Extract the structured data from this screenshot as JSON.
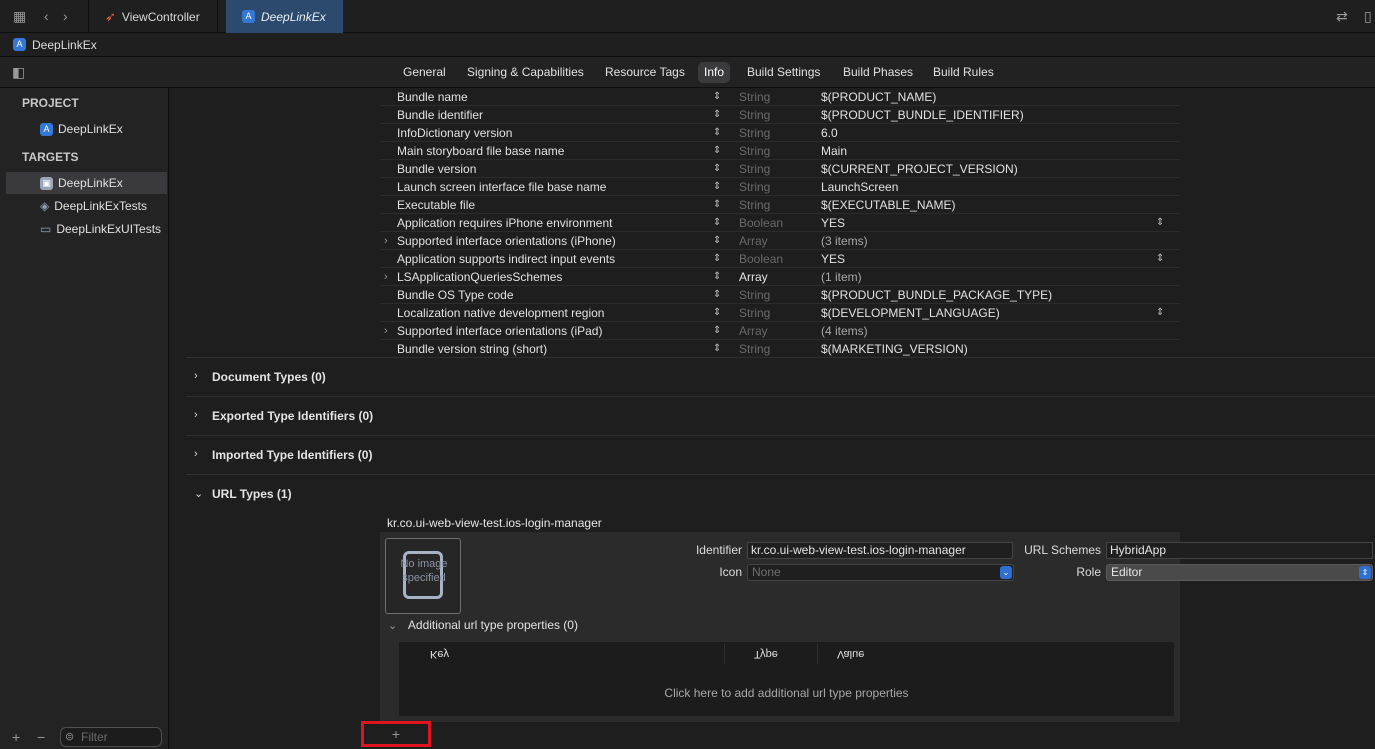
{
  "tabs": {
    "first": "ViewController",
    "second": "DeepLinkEx"
  },
  "jumpbar": {
    "project": "DeepLinkEx"
  },
  "segments": [
    "General",
    "Signing & Capabilities",
    "Resource Tags",
    "Info",
    "Build Settings",
    "Build Phases",
    "Build Rules"
  ],
  "active_segment": "Info",
  "sidebar": {
    "project_header": "PROJECT",
    "project_item": "DeepLinkEx",
    "targets_header": "TARGETS",
    "targets": [
      "DeepLinkEx",
      "DeepLinkExTests",
      "DeepLinkExUITests"
    ],
    "filter_placeholder": "Filter",
    "add_symbol": "+",
    "remove_symbol": "−"
  },
  "info_rows": [
    {
      "key": "Bundle name",
      "type": "String",
      "value": "$(PRODUCT_NAME)",
      "expandable": false,
      "value_popup": false,
      "type_strong": false,
      "value_dim": false
    },
    {
      "key": "Bundle identifier",
      "type": "String",
      "value": "$(PRODUCT_BUNDLE_IDENTIFIER)",
      "expandable": false,
      "value_popup": false,
      "type_strong": false,
      "value_dim": false
    },
    {
      "key": "InfoDictionary version",
      "type": "String",
      "value": "6.0",
      "expandable": false,
      "value_popup": false,
      "type_strong": false,
      "value_dim": false
    },
    {
      "key": "Main storyboard file base name",
      "type": "String",
      "value": "Main",
      "expandable": false,
      "value_popup": false,
      "type_strong": false,
      "value_dim": false
    },
    {
      "key": "Bundle version",
      "type": "String",
      "value": "$(CURRENT_PROJECT_VERSION)",
      "expandable": false,
      "value_popup": false,
      "type_strong": false,
      "value_dim": false
    },
    {
      "key": "Launch screen interface file base name",
      "type": "String",
      "value": "LaunchScreen",
      "expandable": false,
      "value_popup": false,
      "type_strong": false,
      "value_dim": false
    },
    {
      "key": "Executable file",
      "type": "String",
      "value": "$(EXECUTABLE_NAME)",
      "expandable": false,
      "value_popup": false,
      "type_strong": false,
      "value_dim": false
    },
    {
      "key": "Application requires iPhone environment",
      "type": "Boolean",
      "value": "YES",
      "expandable": false,
      "value_popup": true,
      "type_strong": false,
      "value_dim": false
    },
    {
      "key": "Supported interface orientations (iPhone)",
      "type": "Array",
      "value": "(3 items)",
      "expandable": true,
      "value_popup": false,
      "type_strong": false,
      "value_dim": true
    },
    {
      "key": "Application supports indirect input events",
      "type": "Boolean",
      "value": "YES",
      "expandable": false,
      "value_popup": true,
      "type_strong": false,
      "value_dim": false
    },
    {
      "key": "LSApplicationQueriesSchemes",
      "type": "Array",
      "value": "(1 item)",
      "expandable": true,
      "value_popup": false,
      "type_strong": true,
      "value_dim": true
    },
    {
      "key": "Bundle OS Type code",
      "type": "String",
      "value": "$(PRODUCT_BUNDLE_PACKAGE_TYPE)",
      "expandable": false,
      "value_popup": false,
      "type_strong": false,
      "value_dim": false
    },
    {
      "key": "Localization native development region",
      "type": "String",
      "value": "$(DEVELOPMENT_LANGUAGE)",
      "expandable": false,
      "value_popup": true,
      "type_strong": false,
      "value_dim": false
    },
    {
      "key": "Supported interface orientations (iPad)",
      "type": "Array",
      "value": "(4 items)",
      "expandable": true,
      "value_popup": false,
      "type_strong": false,
      "value_dim": true
    },
    {
      "key": "Bundle version string (short)",
      "type": "String",
      "value": "$(MARKETING_VERSION)",
      "expandable": false,
      "value_popup": false,
      "type_strong": false,
      "value_dim": false
    }
  ],
  "sections": {
    "document_types": "Document Types (0)",
    "exported_types": "Exported Type Identifiers (0)",
    "imported_types": "Imported Type Identifiers (0)",
    "url_types": "URL Types (1)"
  },
  "url_type": {
    "heading": "kr.co.ui-web-view-test.ios-login-manager",
    "no_image_text": "No image specified",
    "identifier_label": "Identifier",
    "identifier_value": "kr.co.ui-web-view-test.ios-login-manager",
    "icon_label": "Icon",
    "icon_value": "None",
    "url_schemes_label": "URL Schemes",
    "url_schemes_value": "HybridApp",
    "role_label": "Role",
    "role_value": "Editor",
    "additional_title": "Additional url type properties (0)",
    "columns": [
      "Key",
      "Type",
      "Value"
    ],
    "empty_message": "Click here to add additional url type properties",
    "add_symbol": "+"
  },
  "colors": {
    "highlight_box": "#e0141e",
    "active_tab": "#2c4a6d",
    "popup_accent": "#2f6fd1"
  }
}
